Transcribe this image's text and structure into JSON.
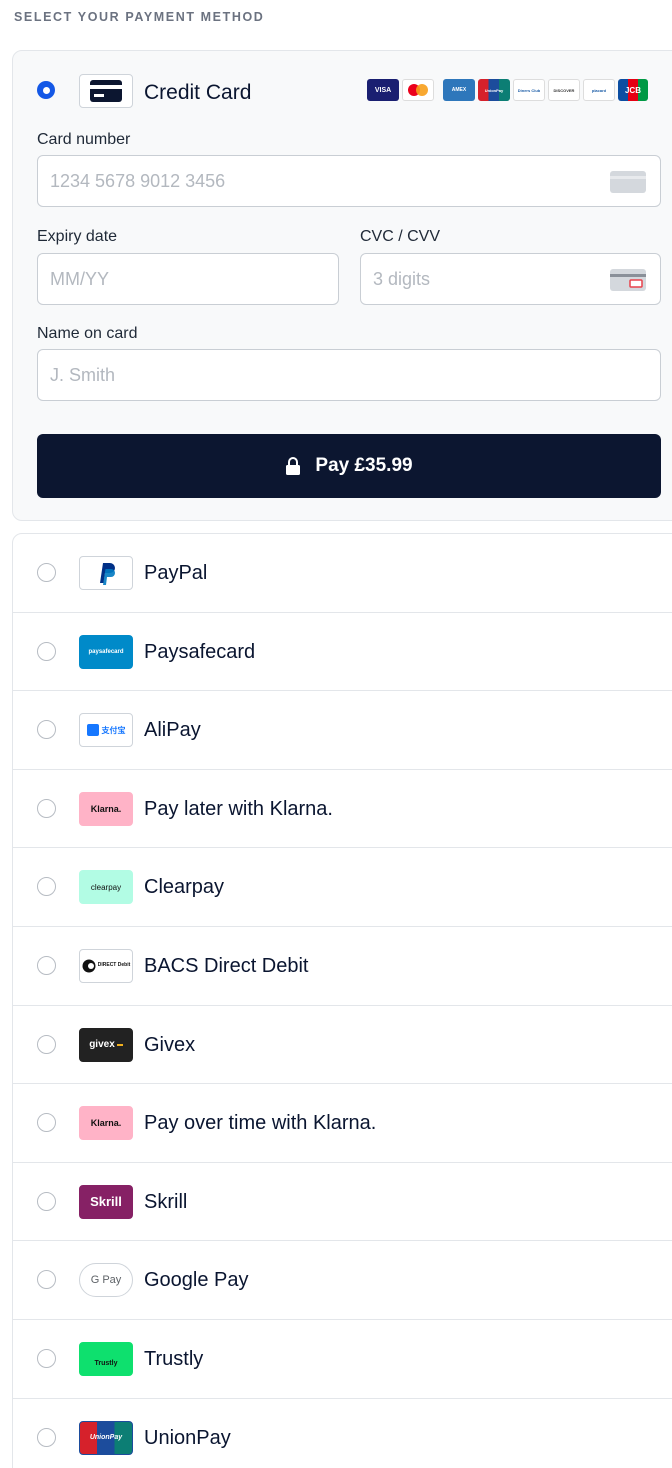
{
  "header": {
    "title": "SELECT YOUR PAYMENT METHOD"
  },
  "credit_card": {
    "label": "Credit Card",
    "brands": [
      "VISA",
      "mastercard",
      "AMEX",
      "UnionPay",
      "Diners Club",
      "DISCOVER",
      "placard",
      "JCB"
    ],
    "fields": {
      "card_number": {
        "label": "Card number",
        "placeholder": "1234 5678 9012 3456"
      },
      "expiry": {
        "label": "Expiry date",
        "placeholder": "MM/YY"
      },
      "cvc": {
        "label": "CVC / CVV",
        "placeholder": "3 digits"
      },
      "name": {
        "label": "Name on card",
        "placeholder": "J. Smith"
      }
    },
    "pay_button": "Pay £35.99",
    "accent_color": "#1458e6",
    "button_color": "#0c1630"
  },
  "methods": [
    {
      "label": "PayPal",
      "logo": "paypal-logo"
    },
    {
      "label": "Paysafecard",
      "logo": "paysafecard-logo",
      "logo_text": "paysafecard"
    },
    {
      "label": "AliPay",
      "logo": "alipay-logo",
      "logo_text": "支付宝"
    },
    {
      "label": "Pay later with Klarna.",
      "logo": "klarna-logo",
      "logo_text": "Klarna."
    },
    {
      "label": "Clearpay",
      "logo": "clearpay-logo",
      "logo_text": "clearpay"
    },
    {
      "label": "BACS Direct Debit",
      "logo": "direct-debit-logo",
      "logo_text": "DIRECT Debit"
    },
    {
      "label": "Givex",
      "logo": "givex-logo",
      "logo_text": "givex"
    },
    {
      "label": "Pay over time with Klarna.",
      "logo": "klarna-logo",
      "logo_text": "Klarna."
    },
    {
      "label": "Skrill",
      "logo": "skrill-logo",
      "logo_text": "Skrill"
    },
    {
      "label": "Google Pay",
      "logo": "google-pay-logo",
      "logo_text": "G Pay"
    },
    {
      "label": "Trustly",
      "logo": "trustly-logo",
      "logo_text": "Trustly"
    },
    {
      "label": "UnionPay",
      "logo": "unionpay-logo",
      "logo_text": "UnionPay"
    }
  ]
}
